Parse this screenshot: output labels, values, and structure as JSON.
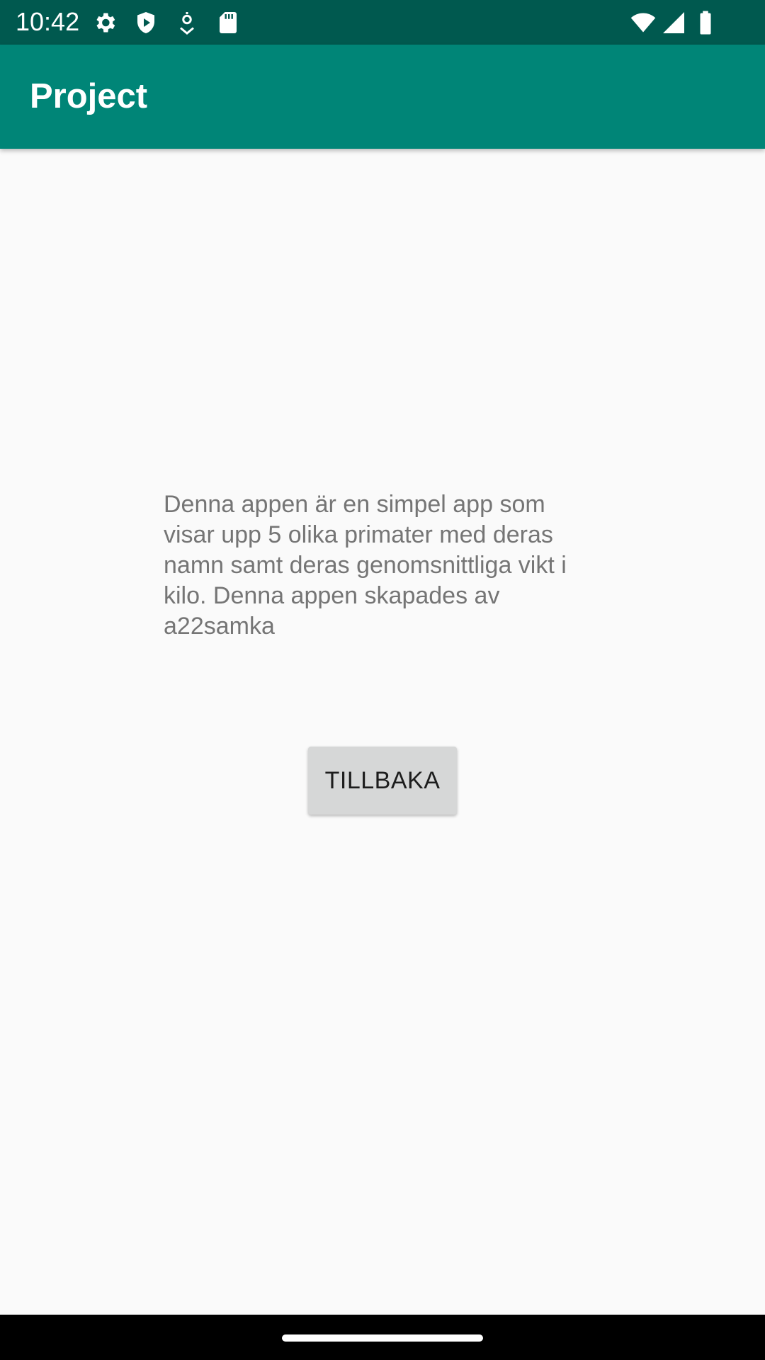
{
  "status_bar": {
    "time": "10:42",
    "left_icons": [
      "gear-icon",
      "shield-icon",
      "location-icon",
      "sd-card-icon"
    ],
    "right_icons": [
      "wifi-icon",
      "signal-icon",
      "battery-icon"
    ],
    "background": "#00594f"
  },
  "app_bar": {
    "title": "Project",
    "background": "#008577"
  },
  "main": {
    "description": "Denna appen är en simpel app som visar upp 5 olika primater med deras namn samt deras genomsnittliga vikt i kilo. Denna appen skapades av a22samka",
    "back_button_label": "TILLBAKA"
  },
  "nav_bar": {
    "home_indicator": "home-pill"
  }
}
